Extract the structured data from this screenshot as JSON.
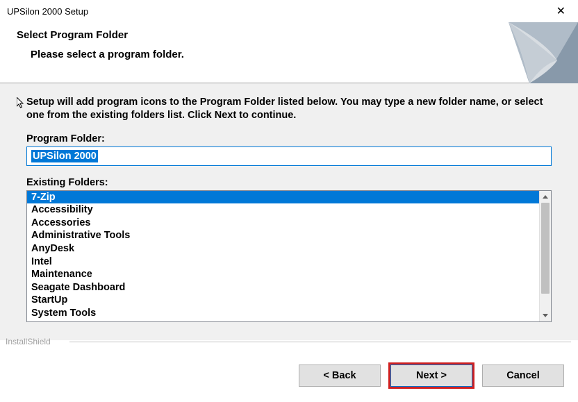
{
  "window": {
    "title": "UPSilon 2000 Setup"
  },
  "header": {
    "title": "Select Program Folder",
    "subtitle": "Please select a program folder."
  },
  "main": {
    "instruction": "Setup will add program icons to the Program Folder listed below.  You may type a new folder name, or select one from the existing folders list.  Click Next to continue.",
    "program_folder_label": "Program Folder:",
    "program_folder_value": "UPSilon 2000",
    "existing_folders_label": "Existing Folders:",
    "existing_folders": [
      "7-Zip",
      "Accessibility",
      "Accessories",
      "Administrative Tools",
      "AnyDesk",
      "Intel",
      "Maintenance",
      "Seagate Dashboard",
      "StartUp",
      "System Tools"
    ],
    "selected_folder_index": 0
  },
  "footer": {
    "brand": "InstallShield",
    "back_label": "< Back",
    "next_label": "Next >",
    "cancel_label": "Cancel"
  }
}
